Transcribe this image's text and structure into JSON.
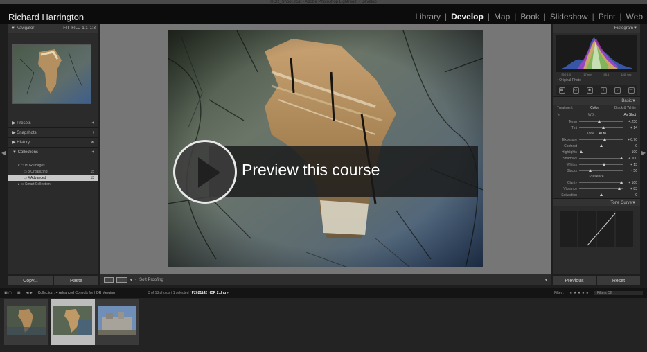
{
  "window_title": "HDR_Shoot.lrcat - Adobe Photoshop Lightroom - Develop",
  "identity_plate": "Richard Harrington",
  "modules": [
    "Library",
    "Develop",
    "Map",
    "Book",
    "Slideshow",
    "Print",
    "Web"
  ],
  "active_module": "Develop",
  "left_panel": {
    "navigator": "Navigator",
    "zoom_options": [
      "FIT",
      "FILL",
      "1:1",
      "1:3"
    ],
    "sections": [
      "Presets",
      "Snapshots",
      "History",
      "Collections"
    ],
    "collections": [
      {
        "name": "HDR Images",
        "count": ""
      },
      {
        "name": "3 Organizing",
        "count": "15"
      },
      {
        "name": "4 Advanced",
        "count": "13"
      },
      {
        "name": "Smart Collection",
        "count": ""
      }
    ],
    "copy_label": "Copy...",
    "paste_label": "Paste"
  },
  "toolbar": {
    "soft_proofing": "Soft Proofing"
  },
  "right_panel": {
    "histogram": "Histogram",
    "hist_info": [
      "ISO 100",
      "17 mm",
      "f/5.6",
      "1/40 sec"
    ],
    "original_photo": "Original Photo",
    "basic": "Basic",
    "treatment_label": "Treatment :",
    "treatment_options": [
      "Color",
      "Black & White"
    ],
    "wb_label": "WB :",
    "wb_value": "As Shot",
    "tone_label": "Tone",
    "tone_auto": "Auto",
    "presence_label": "Presence",
    "sliders_wb": [
      {
        "label": "Temp",
        "value": "4,250",
        "pos": 0.45
      },
      {
        "label": "Tint",
        "value": "+ 14",
        "pos": 0.55
      }
    ],
    "sliders_tone": [
      {
        "label": "Exposure",
        "value": "+ 0.70",
        "pos": 0.58
      },
      {
        "label": "Contrast",
        "value": "0",
        "pos": 0.5
      },
      {
        "label": "Highlights",
        "value": "- 100",
        "pos": 0.05
      },
      {
        "label": "Shadows",
        "value": "+ 100",
        "pos": 0.95
      },
      {
        "label": "Whites",
        "value": "+ 13",
        "pos": 0.56
      },
      {
        "label": "Blacks",
        "value": "- 56",
        "pos": 0.25
      }
    ],
    "sliders_presence": [
      {
        "label": "Clarity",
        "value": "+ 100",
        "pos": 0.95
      },
      {
        "label": "Vibrance",
        "value": "+ 83",
        "pos": 0.9
      },
      {
        "label": "Saturation",
        "value": "0",
        "pos": 0.5
      }
    ],
    "tone_curve": "Tone Curve",
    "previous_label": "Previous",
    "reset_label": "Reset"
  },
  "filmstrip": {
    "path": "Collection : 4 Advanced Controls for HDR Merging",
    "count_info": "3 of 13 photos / 1 selected /",
    "selected_file": "P2021142 HDR 2.dng",
    "filter_label": "Filter :",
    "filters_off": "Filters Off"
  },
  "overlay": {
    "preview_text": "Preview this course"
  }
}
